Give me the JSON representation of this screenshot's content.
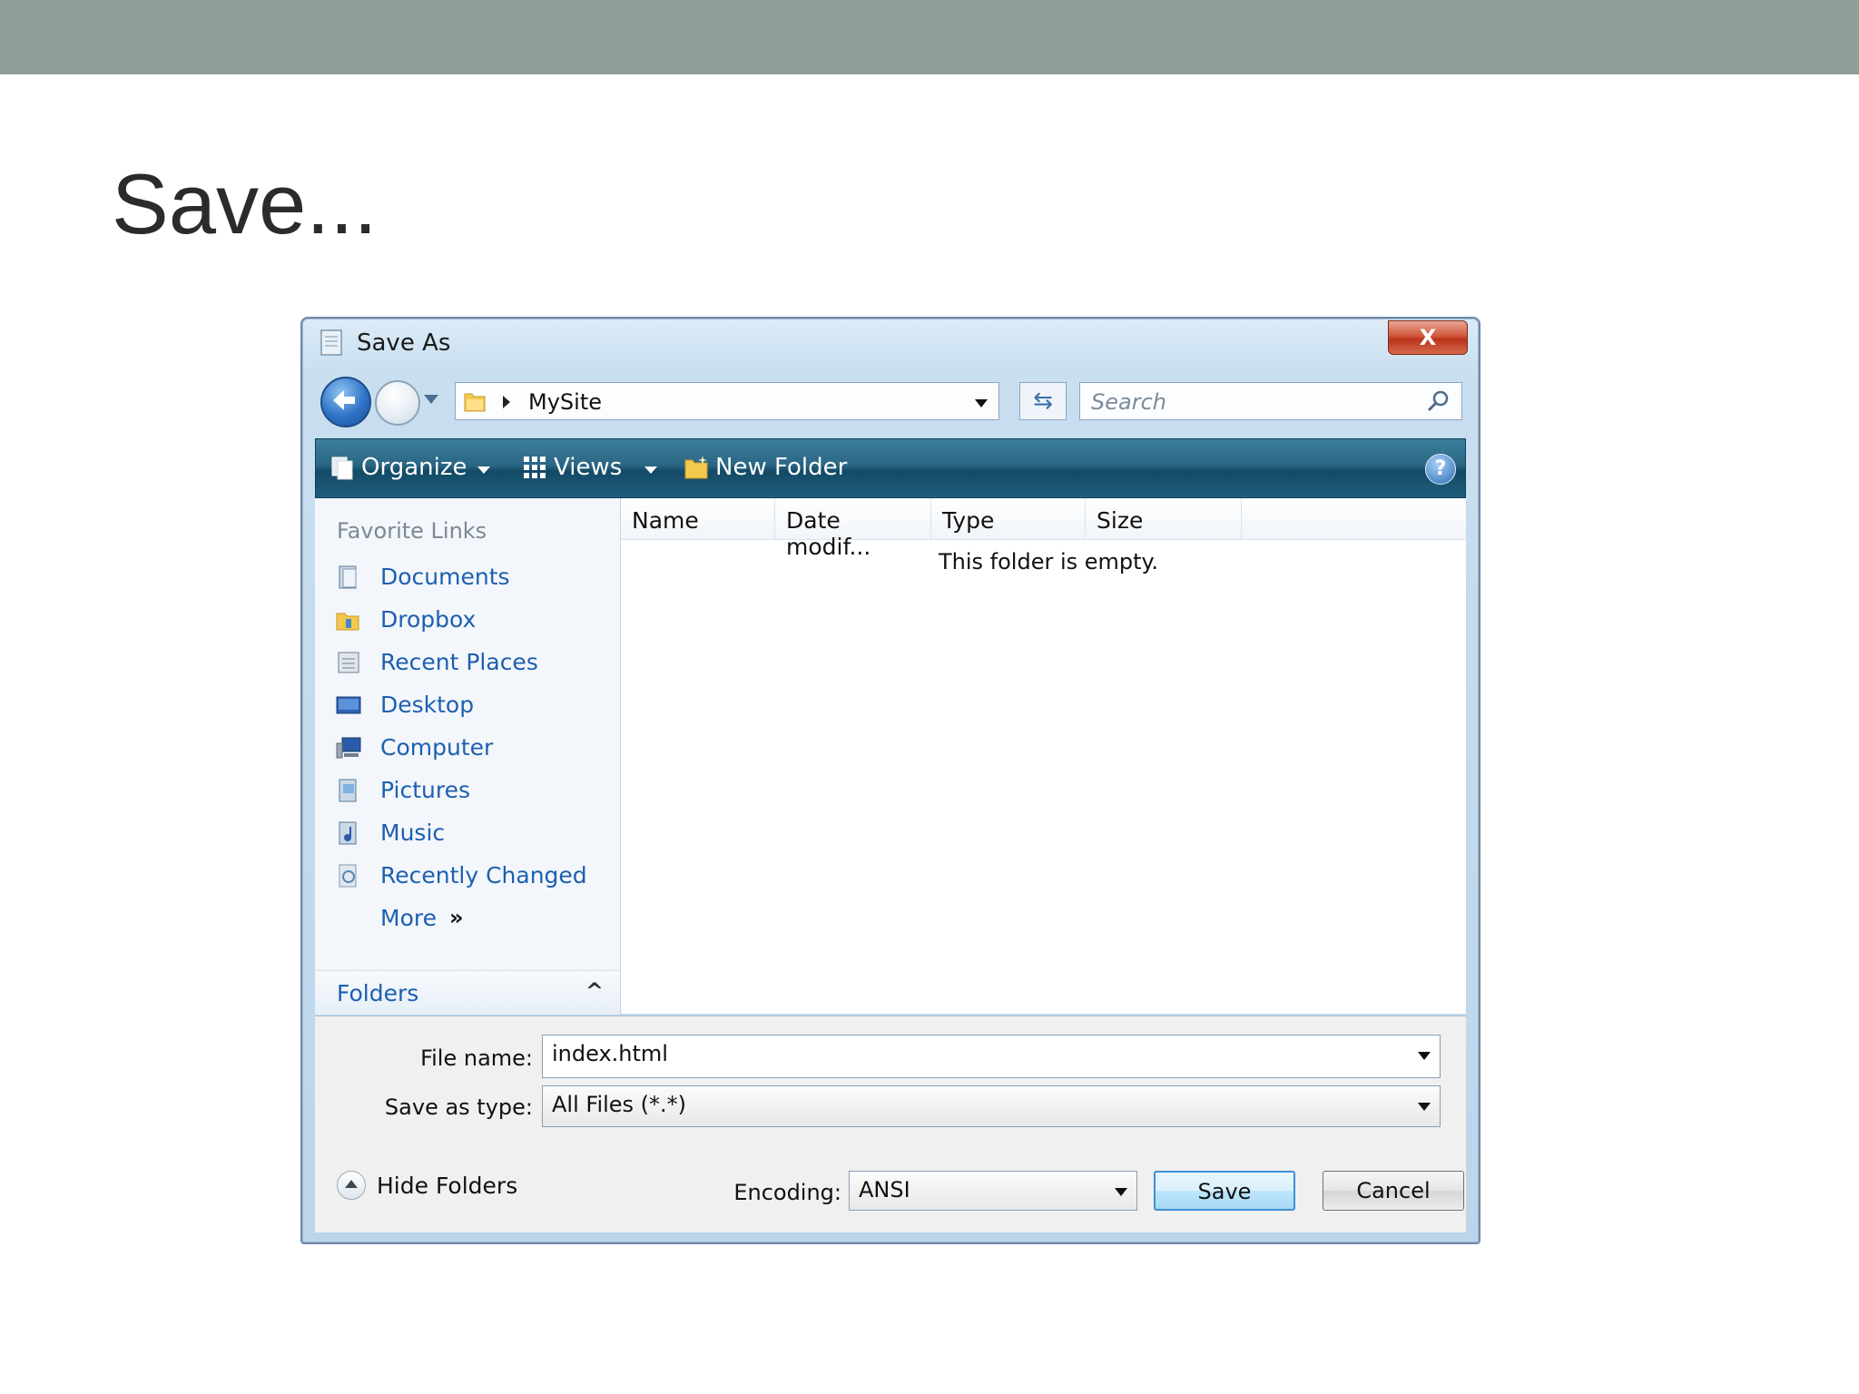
{
  "slide": {
    "title": "Save..."
  },
  "dialog": {
    "title": "Save As",
    "close_label": "X",
    "address_path": "MySite",
    "search_placeholder": "Search",
    "toolbar": {
      "organize": "Organize",
      "views": "Views",
      "new_folder": "New Folder",
      "help": "?"
    },
    "favorite_links_header": "Favorite Links",
    "favorite_links": [
      {
        "label": "Documents",
        "icon": "documents-icon"
      },
      {
        "label": "Dropbox",
        "icon": "dropbox-icon"
      },
      {
        "label": "Recent Places",
        "icon": "recent-places-icon"
      },
      {
        "label": "Desktop",
        "icon": "desktop-icon"
      },
      {
        "label": "Computer",
        "icon": "computer-icon"
      },
      {
        "label": "Pictures",
        "icon": "pictures-icon"
      },
      {
        "label": "Music",
        "icon": "music-icon"
      },
      {
        "label": "Recently Changed",
        "icon": "recently-changed-icon"
      },
      {
        "label": "More",
        "icon": "chevron-double-right-icon"
      }
    ],
    "more_chevron": "»",
    "folders_label": "Folders",
    "folders_chevron": "^",
    "columns": [
      "Name",
      "Date modif...",
      "Type",
      "Size"
    ],
    "empty_message": "This folder is empty.",
    "file_name_label": "File name:",
    "file_name_value": "index.html",
    "save_as_type_label": "Save as type:",
    "save_as_type_value": "All Files  (*.*)",
    "hide_folders_label": "Hide Folders",
    "encoding_label": "Encoding:",
    "encoding_value": "ANSI",
    "save_button": "Save",
    "cancel_button": "Cancel",
    "colors": {
      "toolbar": "#2a6684",
      "link": "#1d5fb0",
      "close": "#c84a2e"
    }
  }
}
